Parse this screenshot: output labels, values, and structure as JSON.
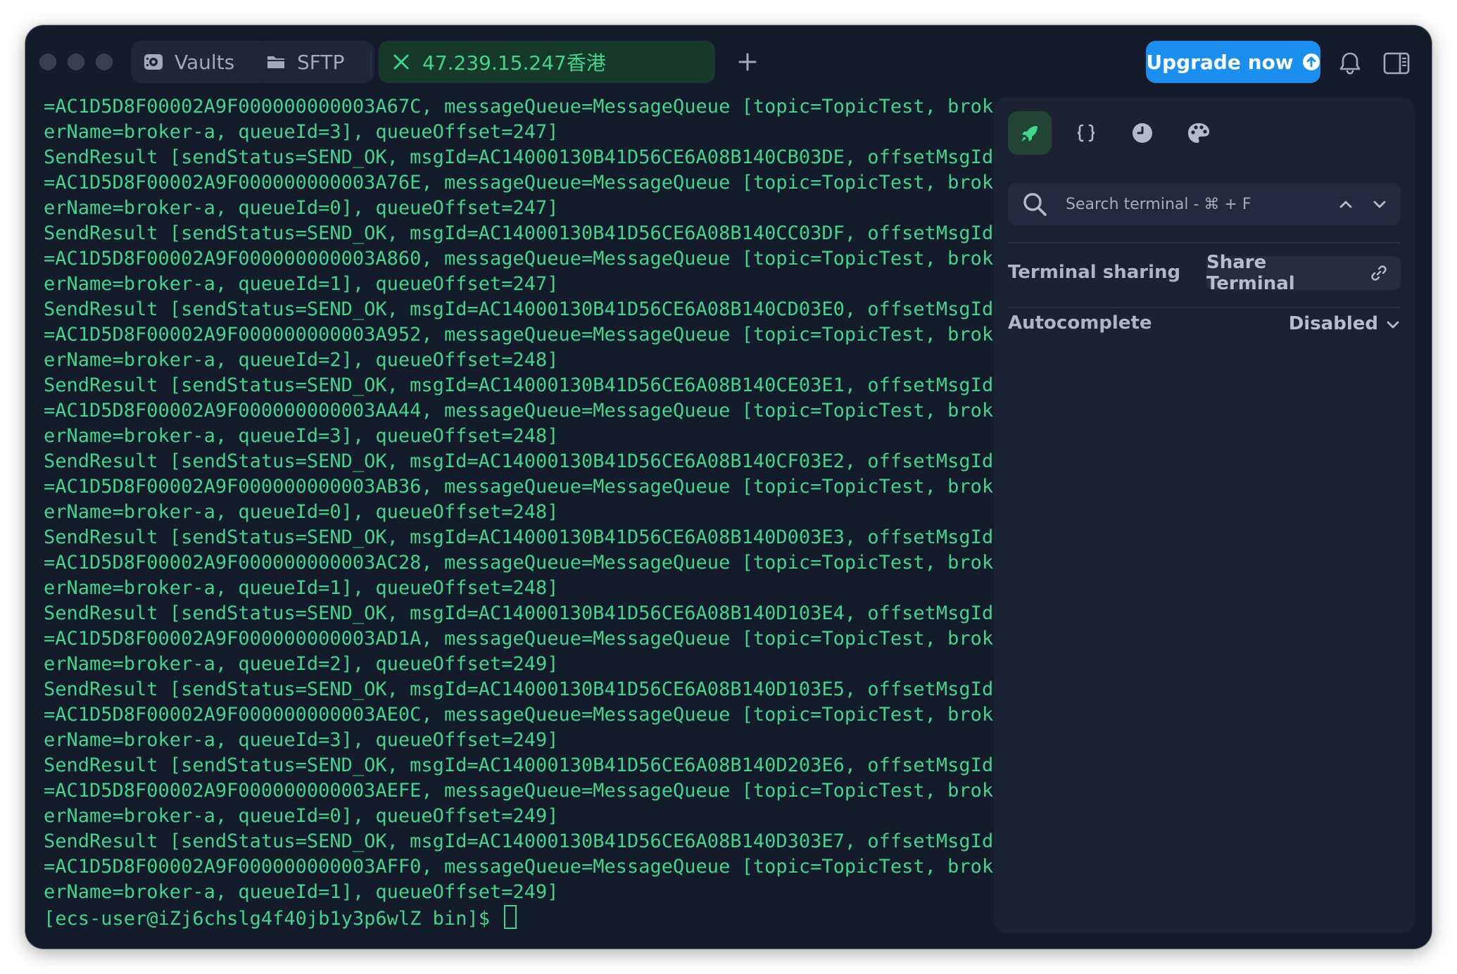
{
  "window": {
    "traffic_lights": [
      "close",
      "minimize",
      "zoom"
    ]
  },
  "tabs": [
    {
      "label": "Vaults",
      "icon": "vault-icon"
    },
    {
      "label": "SFTP",
      "icon": "folder-icon"
    },
    {
      "label": "47.239.15.247香港",
      "icon": "close-icon",
      "active": true
    }
  ],
  "toolbar": {
    "new_tab_icon": "plus-icon",
    "upgrade_label": "Upgrade now",
    "upgrade_icon": "arrow-up-circle-icon",
    "bell_icon": "bell-icon",
    "panel_icon": "side-panel-icon"
  },
  "terminal": {
    "lines": [
      "=AC1D5D8F00002A9F000000000003A67C, messageQueue=MessageQueue [topic=TopicTest, brok",
      "erName=broker-a, queueId=3], queueOffset=247]",
      "SendResult [sendStatus=SEND_OK, msgId=AC14000130B41D56CE6A08B140CB03DE, offsetMsgId",
      "=AC1D5D8F00002A9F000000000003A76E, messageQueue=MessageQueue [topic=TopicTest, brok",
      "erName=broker-a, queueId=0], queueOffset=247]",
      "SendResult [sendStatus=SEND_OK, msgId=AC14000130B41D56CE6A08B140CC03DF, offsetMsgId",
      "=AC1D5D8F00002A9F000000000003A860, messageQueue=MessageQueue [topic=TopicTest, brok",
      "erName=broker-a, queueId=1], queueOffset=247]",
      "SendResult [sendStatus=SEND_OK, msgId=AC14000130B41D56CE6A08B140CD03E0, offsetMsgId",
      "=AC1D5D8F00002A9F000000000003A952, messageQueue=MessageQueue [topic=TopicTest, brok",
      "erName=broker-a, queueId=2], queueOffset=248]",
      "SendResult [sendStatus=SEND_OK, msgId=AC14000130B41D56CE6A08B140CE03E1, offsetMsgId",
      "=AC1D5D8F00002A9F000000000003AA44, messageQueue=MessageQueue [topic=TopicTest, brok",
      "erName=broker-a, queueId=3], queueOffset=248]",
      "SendResult [sendStatus=SEND_OK, msgId=AC14000130B41D56CE6A08B140CF03E2, offsetMsgId",
      "=AC1D5D8F00002A9F000000000003AB36, messageQueue=MessageQueue [topic=TopicTest, brok",
      "erName=broker-a, queueId=0], queueOffset=248]",
      "SendResult [sendStatus=SEND_OK, msgId=AC14000130B41D56CE6A08B140D003E3, offsetMsgId",
      "=AC1D5D8F00002A9F000000000003AC28, messageQueue=MessageQueue [topic=TopicTest, brok",
      "erName=broker-a, queueId=1], queueOffset=248]",
      "SendResult [sendStatus=SEND_OK, msgId=AC14000130B41D56CE6A08B140D103E4, offsetMsgId",
      "=AC1D5D8F00002A9F000000000003AD1A, messageQueue=MessageQueue [topic=TopicTest, brok",
      "erName=broker-a, queueId=2], queueOffset=249]",
      "SendResult [sendStatus=SEND_OK, msgId=AC14000130B41D56CE6A08B140D103E5, offsetMsgId",
      "=AC1D5D8F00002A9F000000000003AE0C, messageQueue=MessageQueue [topic=TopicTest, brok",
      "erName=broker-a, queueId=3], queueOffset=249]",
      "SendResult [sendStatus=SEND_OK, msgId=AC14000130B41D56CE6A08B140D203E6, offsetMsgId",
      "=AC1D5D8F00002A9F000000000003AEFE, messageQueue=MessageQueue [topic=TopicTest, brok",
      "erName=broker-a, queueId=0], queueOffset=249]",
      "SendResult [sendStatus=SEND_OK, msgId=AC14000130B41D56CE6A08B140D303E7, offsetMsgId",
      "=AC1D5D8F00002A9F000000000003AFF0, messageQueue=MessageQueue [topic=TopicTest, brok",
      "erName=broker-a, queueId=1], queueOffset=249]"
    ],
    "prompt": "[ecs-user@iZj6chslg4f40jb1y3p6wlZ bin]$ "
  },
  "side_panel": {
    "tabs": [
      {
        "icon": "rocket-icon",
        "active": true
      },
      {
        "icon": "braces-icon"
      },
      {
        "icon": "history-icon"
      },
      {
        "icon": "palette-icon"
      }
    ],
    "search": {
      "placeholder": "Search terminal - ⌘ + F",
      "icon": "search-icon"
    },
    "terminal_sharing": {
      "label": "Terminal sharing",
      "button_label": "Share Terminal",
      "button_icon": "link-icon"
    },
    "autocomplete": {
      "label": "Autocomplete",
      "value": "Disabled"
    }
  },
  "colors": {
    "window_bg": "#141b2b",
    "terminal_text": "#3fd58a",
    "active_tab_bg": "#17392c",
    "upgrade_bg": "#1a8ff0",
    "panel_bg": "#1a2233"
  }
}
